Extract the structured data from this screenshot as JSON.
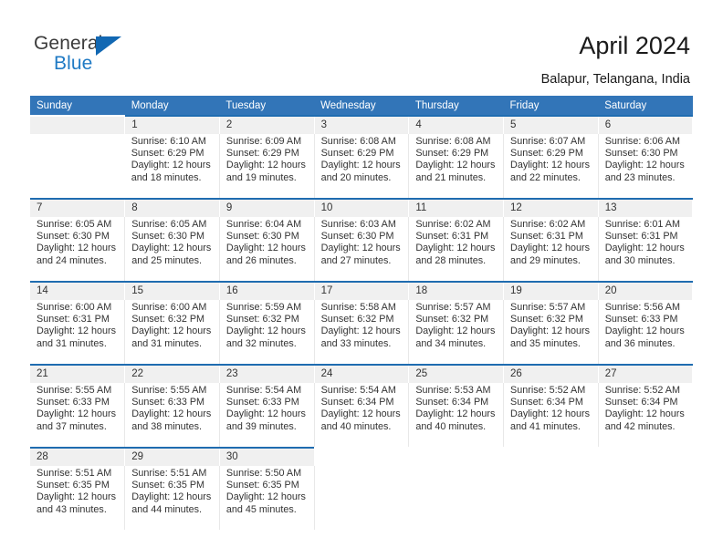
{
  "brand": {
    "name_part1": "General",
    "name_part2": "Blue",
    "triangle_icon": "triangle-icon"
  },
  "header": {
    "title": "April 2024",
    "subtitle": "Balapur, Telangana, India"
  },
  "colors": {
    "header_blue": "#3275b8",
    "rule_blue": "#1f6cb0",
    "daynum_band": "#f0f0f0",
    "brand_blue": "#1268b3",
    "text": "#333333"
  },
  "weekdays": [
    "Sunday",
    "Monday",
    "Tuesday",
    "Wednesday",
    "Thursday",
    "Friday",
    "Saturday"
  ],
  "weeks": [
    [
      {
        "day": "",
        "lines": []
      },
      {
        "day": "1",
        "lines": [
          "Sunrise: 6:10 AM",
          "Sunset: 6:29 PM",
          "Daylight: 12 hours",
          "and 18 minutes."
        ]
      },
      {
        "day": "2",
        "lines": [
          "Sunrise: 6:09 AM",
          "Sunset: 6:29 PM",
          "Daylight: 12 hours",
          "and 19 minutes."
        ]
      },
      {
        "day": "3",
        "lines": [
          "Sunrise: 6:08 AM",
          "Sunset: 6:29 PM",
          "Daylight: 12 hours",
          "and 20 minutes."
        ]
      },
      {
        "day": "4",
        "lines": [
          "Sunrise: 6:08 AM",
          "Sunset: 6:29 PM",
          "Daylight: 12 hours",
          "and 21 minutes."
        ]
      },
      {
        "day": "5",
        "lines": [
          "Sunrise: 6:07 AM",
          "Sunset: 6:29 PM",
          "Daylight: 12 hours",
          "and 22 minutes."
        ]
      },
      {
        "day": "6",
        "lines": [
          "Sunrise: 6:06 AM",
          "Sunset: 6:30 PM",
          "Daylight: 12 hours",
          "and 23 minutes."
        ]
      }
    ],
    [
      {
        "day": "7",
        "lines": [
          "Sunrise: 6:05 AM",
          "Sunset: 6:30 PM",
          "Daylight: 12 hours",
          "and 24 minutes."
        ]
      },
      {
        "day": "8",
        "lines": [
          "Sunrise: 6:05 AM",
          "Sunset: 6:30 PM",
          "Daylight: 12 hours",
          "and 25 minutes."
        ]
      },
      {
        "day": "9",
        "lines": [
          "Sunrise: 6:04 AM",
          "Sunset: 6:30 PM",
          "Daylight: 12 hours",
          "and 26 minutes."
        ]
      },
      {
        "day": "10",
        "lines": [
          "Sunrise: 6:03 AM",
          "Sunset: 6:30 PM",
          "Daylight: 12 hours",
          "and 27 minutes."
        ]
      },
      {
        "day": "11",
        "lines": [
          "Sunrise: 6:02 AM",
          "Sunset: 6:31 PM",
          "Daylight: 12 hours",
          "and 28 minutes."
        ]
      },
      {
        "day": "12",
        "lines": [
          "Sunrise: 6:02 AM",
          "Sunset: 6:31 PM",
          "Daylight: 12 hours",
          "and 29 minutes."
        ]
      },
      {
        "day": "13",
        "lines": [
          "Sunrise: 6:01 AM",
          "Sunset: 6:31 PM",
          "Daylight: 12 hours",
          "and 30 minutes."
        ]
      }
    ],
    [
      {
        "day": "14",
        "lines": [
          "Sunrise: 6:00 AM",
          "Sunset: 6:31 PM",
          "Daylight: 12 hours",
          "and 31 minutes."
        ]
      },
      {
        "day": "15",
        "lines": [
          "Sunrise: 6:00 AM",
          "Sunset: 6:32 PM",
          "Daylight: 12 hours",
          "and 31 minutes."
        ]
      },
      {
        "day": "16",
        "lines": [
          "Sunrise: 5:59 AM",
          "Sunset: 6:32 PM",
          "Daylight: 12 hours",
          "and 32 minutes."
        ]
      },
      {
        "day": "17",
        "lines": [
          "Sunrise: 5:58 AM",
          "Sunset: 6:32 PM",
          "Daylight: 12 hours",
          "and 33 minutes."
        ]
      },
      {
        "day": "18",
        "lines": [
          "Sunrise: 5:57 AM",
          "Sunset: 6:32 PM",
          "Daylight: 12 hours",
          "and 34 minutes."
        ]
      },
      {
        "day": "19",
        "lines": [
          "Sunrise: 5:57 AM",
          "Sunset: 6:32 PM",
          "Daylight: 12 hours",
          "and 35 minutes."
        ]
      },
      {
        "day": "20",
        "lines": [
          "Sunrise: 5:56 AM",
          "Sunset: 6:33 PM",
          "Daylight: 12 hours",
          "and 36 minutes."
        ]
      }
    ],
    [
      {
        "day": "21",
        "lines": [
          "Sunrise: 5:55 AM",
          "Sunset: 6:33 PM",
          "Daylight: 12 hours",
          "and 37 minutes."
        ]
      },
      {
        "day": "22",
        "lines": [
          "Sunrise: 5:55 AM",
          "Sunset: 6:33 PM",
          "Daylight: 12 hours",
          "and 38 minutes."
        ]
      },
      {
        "day": "23",
        "lines": [
          "Sunrise: 5:54 AM",
          "Sunset: 6:33 PM",
          "Daylight: 12 hours",
          "and 39 minutes."
        ]
      },
      {
        "day": "24",
        "lines": [
          "Sunrise: 5:54 AM",
          "Sunset: 6:34 PM",
          "Daylight: 12 hours",
          "and 40 minutes."
        ]
      },
      {
        "day": "25",
        "lines": [
          "Sunrise: 5:53 AM",
          "Sunset: 6:34 PM",
          "Daylight: 12 hours",
          "and 40 minutes."
        ]
      },
      {
        "day": "26",
        "lines": [
          "Sunrise: 5:52 AM",
          "Sunset: 6:34 PM",
          "Daylight: 12 hours",
          "and 41 minutes."
        ]
      },
      {
        "day": "27",
        "lines": [
          "Sunrise: 5:52 AM",
          "Sunset: 6:34 PM",
          "Daylight: 12 hours",
          "and 42 minutes."
        ]
      }
    ],
    [
      {
        "day": "28",
        "lines": [
          "Sunrise: 5:51 AM",
          "Sunset: 6:35 PM",
          "Daylight: 12 hours",
          "and 43 minutes."
        ]
      },
      {
        "day": "29",
        "lines": [
          "Sunrise: 5:51 AM",
          "Sunset: 6:35 PM",
          "Daylight: 12 hours",
          "and 44 minutes."
        ]
      },
      {
        "day": "30",
        "lines": [
          "Sunrise: 5:50 AM",
          "Sunset: 6:35 PM",
          "Daylight: 12 hours",
          "and 45 minutes."
        ]
      },
      {
        "day": "",
        "lines": []
      },
      {
        "day": "",
        "lines": []
      },
      {
        "day": "",
        "lines": []
      },
      {
        "day": "",
        "lines": []
      }
    ]
  ]
}
